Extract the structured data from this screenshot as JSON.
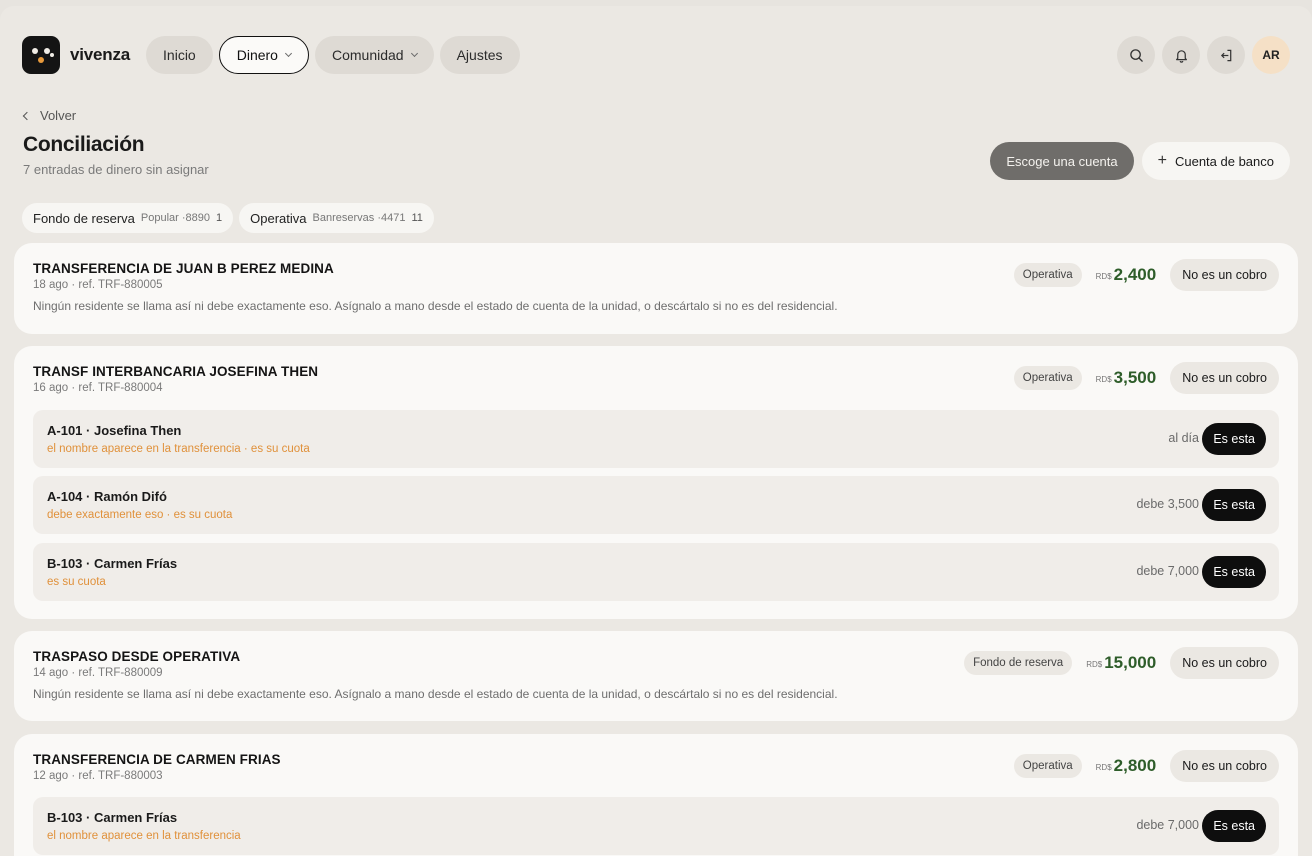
{
  "header": {
    "brand": "vivenza",
    "nav": [
      {
        "label": "Inicio"
      },
      {
        "label": "Dinero"
      },
      {
        "label": "Comunidad"
      },
      {
        "label": "Ajustes"
      }
    ],
    "avatar_initials": "AR"
  },
  "page": {
    "back_label": "Volver",
    "title": "Conciliación",
    "subtitle": "7 entradas de dinero sin asignar",
    "choose_account_label": "Escoge una cuenta",
    "add_bank_label": "Cuenta de banco"
  },
  "filters": [
    {
      "name": "Fondo de reserva",
      "bank": "Popular ·8890",
      "count": "1"
    },
    {
      "name": "Operativa",
      "bank": "Banreservas ·4471",
      "count": "11"
    }
  ],
  "labels": {
    "not_payment": "No es un cobro",
    "is_this": "Es esta",
    "currency": "RD$"
  },
  "entries": [
    {
      "title": "TRANSFERENCIA DE JUAN B PEREZ MEDINA",
      "meta": "18 ago · ref. TRF-880005",
      "account": "Operativa",
      "amount": "2,400",
      "note": "Ningún residente se llama así ni debe exactamente eso. Asígnalo a mano desde el estado de cuenta de la unidad, o descártalo si no es del residencial."
    },
    {
      "title": "TRANSF INTERBANCARIA JOSEFINA THEN",
      "meta": "16 ago · ref. TRF-880004",
      "account": "Operativa",
      "amount": "3,500",
      "candidates": [
        {
          "name": "A-101 · Josefina Then",
          "hint": "el nombre aparece en la transferencia · es su cuota",
          "status": "al día"
        },
        {
          "name": "A-104 · Ramón Difó",
          "hint": "debe exactamente eso · es su cuota",
          "status": "debe 3,500"
        },
        {
          "name": "B-103 · Carmen Frías",
          "hint": "es su cuota",
          "status": "debe 7,000"
        }
      ]
    },
    {
      "title": "TRASPASO DESDE OPERATIVA",
      "meta": "14 ago · ref. TRF-880009",
      "account": "Fondo de reserva",
      "amount": "15,000",
      "note": "Ningún residente se llama así ni debe exactamente eso. Asígnalo a mano desde el estado de cuenta de la unidad, o descártalo si no es del residencial."
    },
    {
      "title": "TRANSFERENCIA DE CARMEN FRIAS",
      "meta": "12 ago · ref. TRF-880003",
      "account": "Operativa",
      "amount": "2,800",
      "candidates": [
        {
          "name": "B-103 · Carmen Frías",
          "hint": "el nombre aparece en la transferencia",
          "status": "debe 7,000"
        }
      ]
    }
  ]
}
